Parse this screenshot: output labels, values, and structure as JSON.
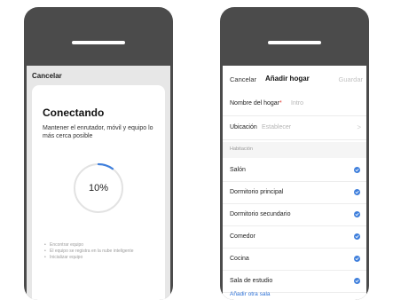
{
  "left": {
    "cancel_label": "Cancelar",
    "title": "Conectando",
    "description": "Mantener el enrutador, móvil y equipo lo más cerca posible",
    "progress_label": "10%",
    "progress_fraction": 0.1,
    "steps": [
      "Encontrar equipo",
      "El equipo se registra en la nube inteligente",
      "Inicializar equipo"
    ]
  },
  "right": {
    "cancel_label": "Cancelar",
    "title": "Añadir hogar",
    "save_label": "Guardar",
    "home_name_label": "Nombre del hogar",
    "home_name_required": "*",
    "home_name_placeholder": "Intro",
    "location_label": "Ubicación",
    "location_value": "Establecer",
    "location_chevron": ">",
    "rooms_header": "Habitación",
    "rooms": [
      {
        "name": "Salón",
        "checked": true
      },
      {
        "name": "Dormitorio principal",
        "checked": true
      },
      {
        "name": "Dormitorio secundario",
        "checked": true
      },
      {
        "name": "Comedor",
        "checked": true
      },
      {
        "name": "Cocina",
        "checked": true
      },
      {
        "name": "Sala de estudio",
        "checked": true
      }
    ],
    "add_room_label": "Añadir otra sala"
  },
  "colors": {
    "phone_body": "#4b4b4b",
    "accent_blue": "#3f7fdc",
    "link_blue": "#2f73d8",
    "required_red": "#e0352b"
  }
}
